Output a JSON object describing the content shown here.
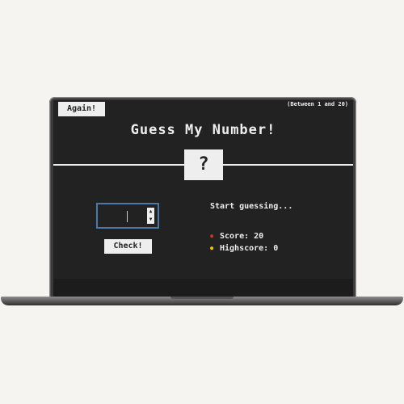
{
  "game": {
    "again_label": "Again!",
    "range_note": "(Between 1 and 20)",
    "title": "Guess My Number!",
    "secret_display": "?",
    "guess_value": "",
    "check_label": "Check!",
    "message": "Start guessing...",
    "score_label": "Score:",
    "score_value": "20",
    "highscore_label": "Highscore:",
    "highscore_value": "0",
    "score_icon": "💯",
    "highscore_icon": "🥇"
  },
  "colors": {
    "background": "#222222",
    "text": "#eeeeee",
    "page_background": "#f5f4f0",
    "input_border": "#4a78a8"
  }
}
